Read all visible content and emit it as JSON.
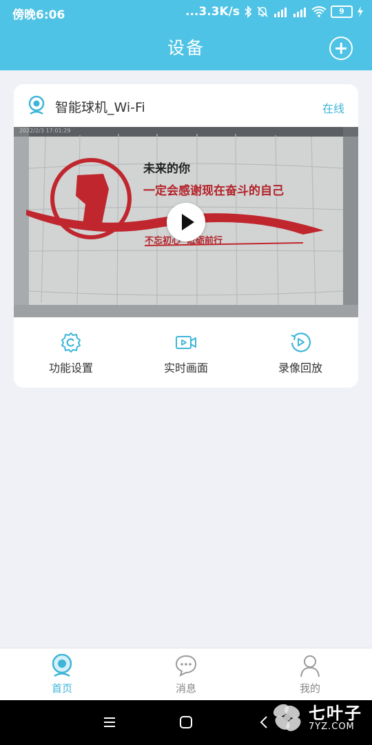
{
  "status_bar": {
    "time": "傍晚6:06",
    "network_speed": "...3.3K/s",
    "battery": "9"
  },
  "header": {
    "title": "设备"
  },
  "device": {
    "name": "智能球机_Wi-Fi",
    "status": "在线",
    "preview": {
      "timestamp": "2022/2/3 17:01:29",
      "slogan_line1": "未来的你",
      "slogan_line2": "一定会感谢现在奋斗的自己",
      "slogan_line3": "不忘初心  砥砺前行"
    }
  },
  "actions": [
    {
      "label": "功能设置",
      "icon": "gear-icon"
    },
    {
      "label": "实时画面",
      "icon": "video-camera-icon"
    },
    {
      "label": "录像回放",
      "icon": "replay-icon"
    }
  ],
  "tabbar": {
    "items": [
      {
        "label": "首页",
        "icon": "camera-home-icon",
        "active": true
      },
      {
        "label": "消息",
        "icon": "chat-bubble-icon",
        "active": false
      },
      {
        "label": "我的",
        "icon": "user-icon",
        "active": false
      }
    ]
  },
  "watermark": {
    "brand": "七叶子",
    "domain": "7YZ.COM"
  },
  "colors": {
    "accent": "#4ec3e5",
    "accent_text": "#3eb5d8",
    "background": "#eff1f6"
  }
}
